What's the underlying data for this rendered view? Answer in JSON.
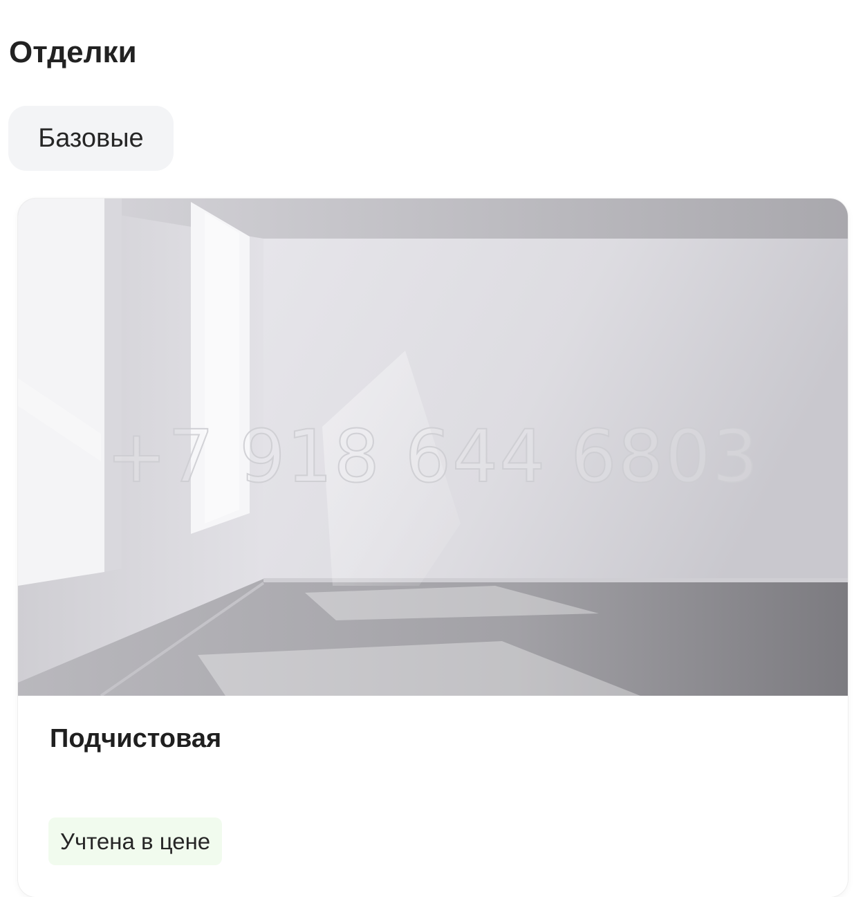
{
  "section": {
    "title": "Отделки"
  },
  "filters": [
    {
      "label": "Базовые",
      "selected": true
    }
  ],
  "card": {
    "image_name": "empty-room-photo",
    "watermark": "+7 918 644 6803",
    "title": "Подчистовая",
    "badge": "Учтена в цене"
  },
  "colors": {
    "chip_background": "#f3f4f6",
    "badge_background": "#f1fbee",
    "text": "#222222"
  }
}
